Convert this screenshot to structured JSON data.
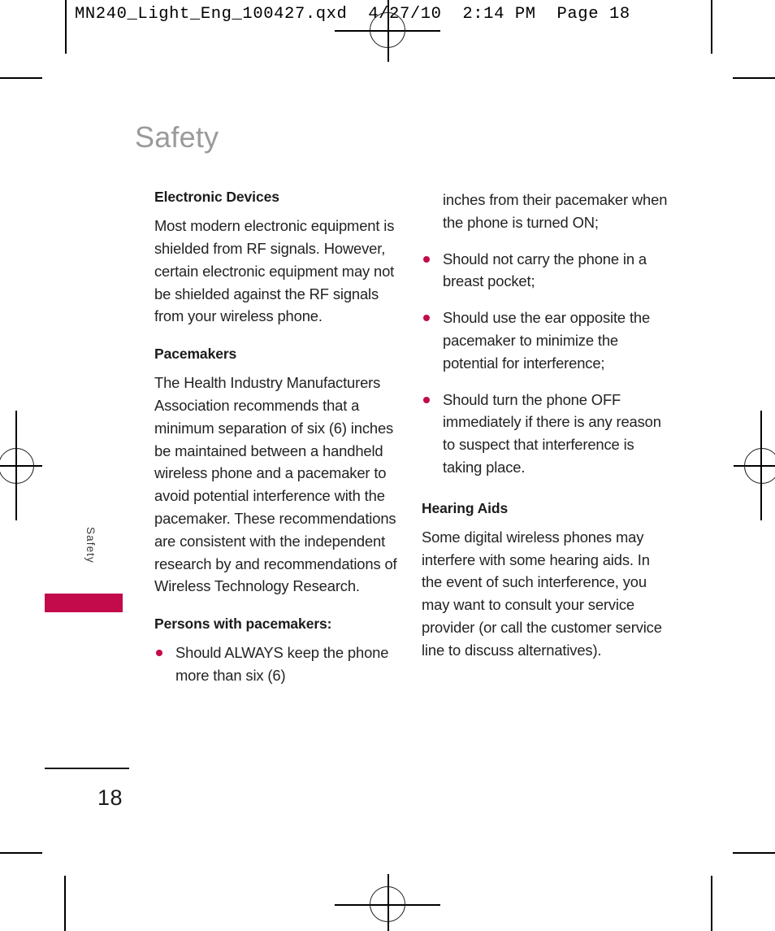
{
  "print_header": "MN240_Light_Eng_100427.qxd  4/27/10  2:14 PM  Page 18",
  "chapter": {
    "title": "Safety",
    "side_tab_label": "Safety"
  },
  "folio": {
    "page_number": "18"
  },
  "colors": {
    "accent": "#c30a4b",
    "title_gray": "#9a9a9a",
    "body_text": "#232323",
    "heading_text": "#1b1b1b"
  },
  "left_column": {
    "heading_1": "Electronic Devices",
    "paragraph_1": "Most modern electronic equipment is shielded from RF signals. However, certain electronic equipment may not be shielded against the RF signals from your wireless phone.",
    "heading_2": "Pacemakers",
    "paragraph_2": "The Health Industry Manufacturers Association recommends that a minimum separation of six (6) inches be maintained between a handheld wireless phone and a pacemaker to avoid potential interference with the pacemaker. These recommendations are consistent with the independent research by and recommendations of Wireless Technology Research.",
    "heading_3": "Persons with pacemakers:",
    "bullet_1_start": "Should ALWAYS keep the phone more than six (6)"
  },
  "right_column": {
    "bullet_1_continued": "inches from their pacemaker when the phone is turned ON;",
    "bullets": [
      "Should not carry the phone in a breast pocket;",
      "Should use the ear opposite the pacemaker to minimize the potential for interference;",
      "Should turn the phone OFF immediately if there is any reason to suspect that interference is taking place."
    ],
    "heading_1": "Hearing Aids",
    "paragraph_1": "Some digital wireless phones may interfere with some hearing aids. In the event of such interference, you may want to consult your service provider (or call the customer service line to discuss alternatives)."
  }
}
